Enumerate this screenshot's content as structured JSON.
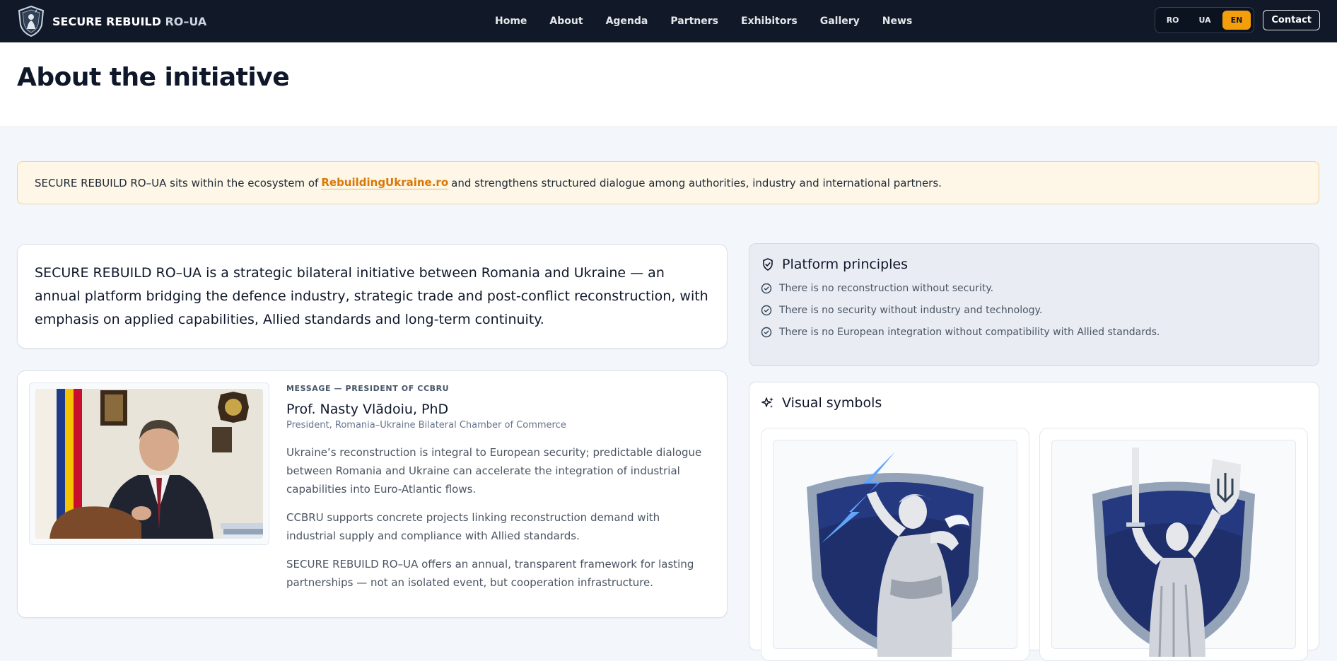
{
  "brand": {
    "name_main": "SECURE REBUILD",
    "name_accent": "RO–UA"
  },
  "nav": {
    "items": [
      "Home",
      "About",
      "Agenda",
      "Partners",
      "Exhibitors",
      "Gallery",
      "News"
    ]
  },
  "languages": {
    "items": [
      "RO",
      "UA",
      "EN"
    ],
    "active": "EN"
  },
  "contact_label": "Contact",
  "page": {
    "title": "About the initiative"
  },
  "notice": {
    "before": "SECURE REBUILD RO–UA sits within the ecosystem of",
    "link": "RebuildingUkraine.ro",
    "after": "and strengthens structured dialogue among authorities, industry and international partners."
  },
  "intro": {
    "text": "SECURE REBUILD RO–UA is a strategic bilateral initiative between Romania and Ukraine — an annual platform bridging the defence industry, strategic trade and post-conflict reconstruction, with emphasis on applied capabilities, Allied standards and long-term continuity."
  },
  "message": {
    "eyebrow": "MESSAGE — PRESIDENT OF CCBRU",
    "name": "Prof. Nasty Vlădoiu, PhD",
    "role": "President, Romania–Ukraine Bilateral Chamber of Commerce",
    "paragraphs": [
      "Ukraine’s reconstruction is integral to European security; predictable dialogue between Romania and Ukraine can accelerate the integration of industrial capabilities into Euro-Atlantic flows.",
      "CCBRU supports concrete projects linking reconstruction demand with industrial supply and compliance with Allied standards.",
      "SECURE REBUILD RO–UA offers an annual, transparent framework for lasting partnerships — not an isolated event, but cooperation infrastructure."
    ]
  },
  "principles": {
    "title": "Platform principles",
    "items": [
      "There is no reconstruction without security.",
      "There is no security without industry and technology.",
      "There is no European integration without compatibility with Allied standards."
    ]
  },
  "symbols": {
    "title": "Visual symbols"
  },
  "colors": {
    "nav_bg": "#111827",
    "accent": "#f59e0b",
    "link": "#d97706",
    "navy": "#1e3a8a"
  }
}
